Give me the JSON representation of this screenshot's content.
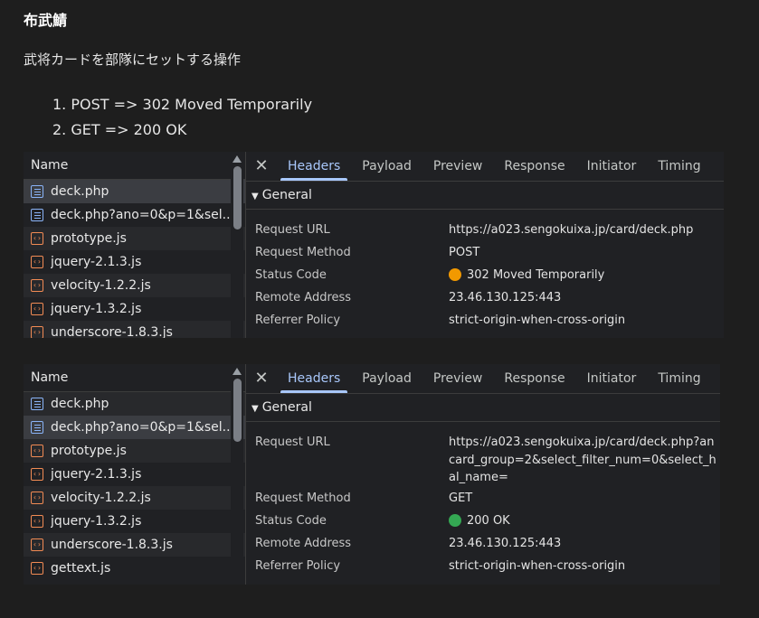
{
  "heading": "布武鯖",
  "description": "武将カードを部隊にセットする操作",
  "steps": [
    "1. POST => 302 Moved Temporarily",
    "2. GET => 200 OK"
  ],
  "panel1": {
    "name_header": "Name",
    "rows": [
      {
        "label": "deck.php",
        "icon": "document-icon"
      },
      {
        "label": "deck.php?ano=0&p=1&sel...",
        "icon": "document-icon"
      },
      {
        "label": "prototype.js",
        "icon": "script-icon"
      },
      {
        "label": "jquery-2.1.3.js",
        "icon": "script-icon"
      },
      {
        "label": "velocity-1.2.2.js",
        "icon": "script-icon"
      },
      {
        "label": "jquery-1.3.2.js",
        "icon": "script-icon"
      },
      {
        "label": "underscore-1.8.3.js",
        "icon": "script-icon"
      }
    ],
    "tabs": [
      "Headers",
      "Payload",
      "Preview",
      "Response",
      "Initiator",
      "Timing"
    ],
    "active_tab": "Headers",
    "section": "General",
    "fields": [
      {
        "key": "Request URL",
        "value": "https://a023.sengokuixa.jp/card/deck.php"
      },
      {
        "key": "Request Method",
        "value": "POST"
      },
      {
        "key": "Status Code",
        "value": "302 Moved Temporarily",
        "status_color": "#f29900"
      },
      {
        "key": "Remote Address",
        "value": "23.46.130.125:443"
      },
      {
        "key": "Referrer Policy",
        "value": "strict-origin-when-cross-origin"
      }
    ]
  },
  "panel2": {
    "name_header": "Name",
    "rows": [
      {
        "label": "deck.php",
        "icon": "document-icon"
      },
      {
        "label": "deck.php?ano=0&p=1&sel...",
        "icon": "document-icon"
      },
      {
        "label": "prototype.js",
        "icon": "script-icon"
      },
      {
        "label": "jquery-2.1.3.js",
        "icon": "script-icon"
      },
      {
        "label": "velocity-1.2.2.js",
        "icon": "script-icon"
      },
      {
        "label": "jquery-1.3.2.js",
        "icon": "script-icon"
      },
      {
        "label": "underscore-1.8.3.js",
        "icon": "script-icon"
      },
      {
        "label": "gettext.js",
        "icon": "script-icon"
      }
    ],
    "tabs": [
      "Headers",
      "Payload",
      "Preview",
      "Response",
      "Initiator",
      "Timing"
    ],
    "active_tab": "Headers",
    "section": "General",
    "fields": [
      {
        "key": "Request URL",
        "value": "https://a023.sengokuixa.jp/card/deck.php?an card_group=2&select_filter_num=0&select_h al_name="
      },
      {
        "key": "Request Method",
        "value": "GET"
      },
      {
        "key": "Status Code",
        "value": "200 OK",
        "status_color": "#34a853"
      },
      {
        "key": "Remote Address",
        "value": "23.46.130.125:443"
      },
      {
        "key": "Referrer Policy",
        "value": "strict-origin-when-cross-origin"
      }
    ]
  },
  "close_glyph": "✕",
  "collapse_glyph": "▼"
}
